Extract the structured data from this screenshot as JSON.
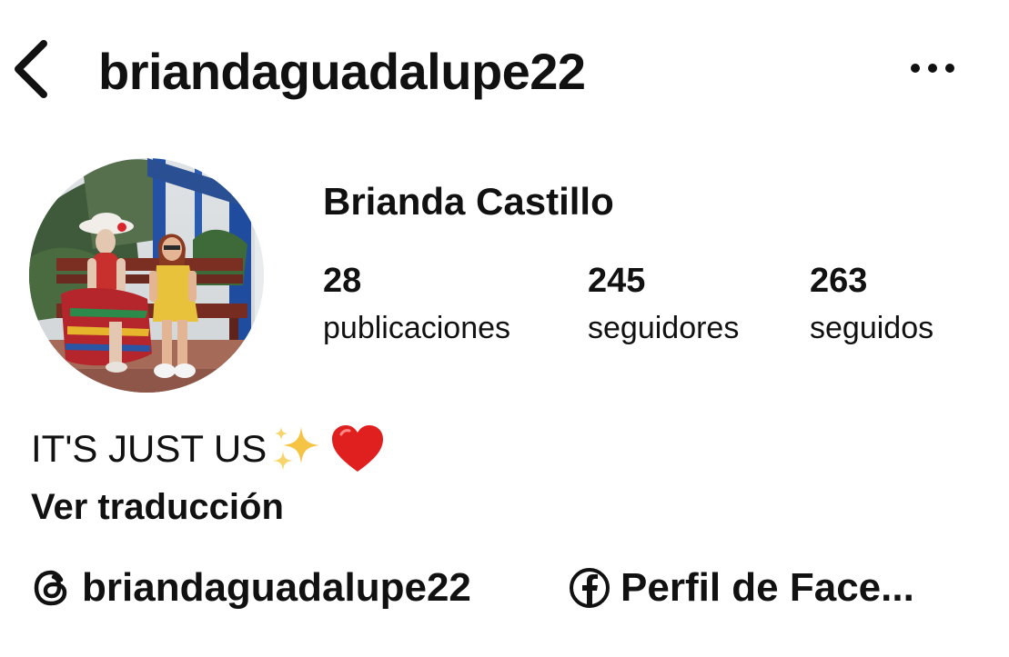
{
  "header": {
    "username": "briandaguadalupe22",
    "back_icon": "chevron-left-icon",
    "more_icon": "more-horizontal-icon"
  },
  "profile": {
    "display_name": "Brianda Castillo",
    "avatar": "profile-photo",
    "stats": [
      {
        "value": "28",
        "label": "publicaciones"
      },
      {
        "value": "245",
        "label": "seguidores"
      },
      {
        "value": "263",
        "label": "seguidos"
      }
    ],
    "bio": {
      "text": "IT'S JUST US",
      "emojis": [
        "sparkles-emoji",
        "red-heart-emoji"
      ]
    },
    "translate_label": "Ver traducción",
    "links": [
      {
        "icon": "threads-icon",
        "label": "briandaguadalupe22"
      },
      {
        "icon": "facebook-icon",
        "label": "Perfil de Face..."
      }
    ]
  },
  "colors": {
    "text": "#111111",
    "background": "#ffffff",
    "heart": "#e0201f",
    "sparkle": "#f6c445"
  }
}
